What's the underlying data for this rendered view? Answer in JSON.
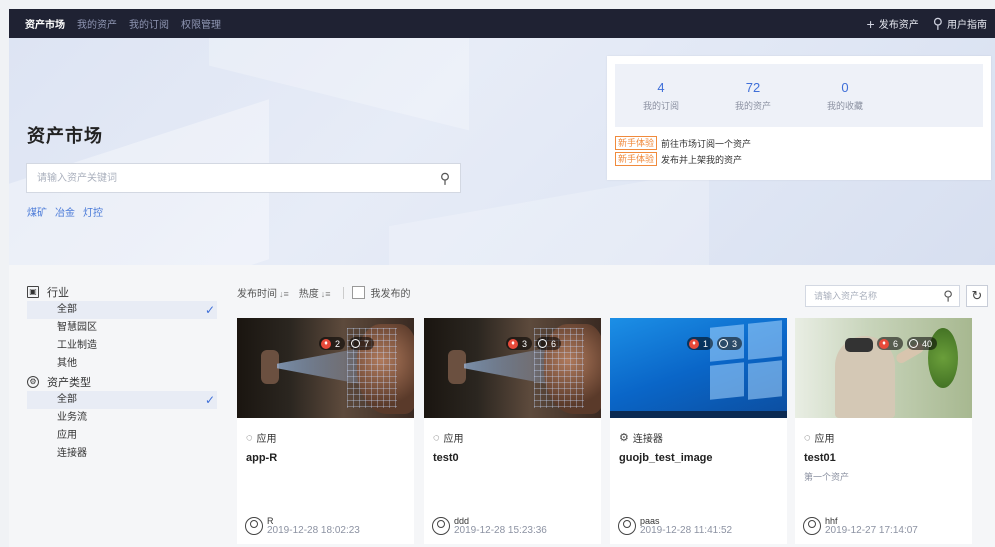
{
  "topbar": {
    "nav": [
      "资产市场",
      "我的资产",
      "我的订阅",
      "权限管理"
    ],
    "publish_label": "发布资产",
    "guide_label": "用户指南"
  },
  "hero": {
    "title": "资产市场",
    "search_placeholder": "请输入资产关键词",
    "tags": [
      "煤矿",
      "冶金",
      "灯控"
    ]
  },
  "stats": {
    "items": [
      {
        "value": "4",
        "label": "我的订阅"
      },
      {
        "value": "72",
        "label": "我的资产"
      },
      {
        "value": "0",
        "label": "我的收藏"
      }
    ],
    "newbie": [
      {
        "tag": "新手体验",
        "text": "前往市场订阅一个资产"
      },
      {
        "tag": "新手体验",
        "text": "发布并上架我的资产"
      }
    ]
  },
  "sidebar": {
    "industry_title": "行业",
    "industry_items": [
      "全部",
      "智慧园区",
      "工业制造",
      "其他"
    ],
    "type_title": "资产类型",
    "type_items": [
      "全部",
      "业务流",
      "应用",
      "连接器"
    ]
  },
  "toolbar": {
    "sort_time": "发布时间",
    "sort_hot": "热度",
    "my_published": "我发布的",
    "name_search_placeholder": "请输入资产名称"
  },
  "cards": [
    {
      "type": "应用",
      "name": "app-R",
      "desc": "",
      "owner": "R",
      "time": "2019-12-28 18:02:23",
      "hot": "2",
      "views": "7"
    },
    {
      "type": "应用",
      "name": "test0",
      "desc": "",
      "owner": "ddd",
      "time": "2019-12-28 15:23:36",
      "hot": "3",
      "views": "6"
    },
    {
      "type": "连接器",
      "name": "guojb_test_image",
      "desc": "",
      "owner": "paas",
      "time": "2019-12-28 11:41:52",
      "hot": "1",
      "views": "3"
    },
    {
      "type": "应用",
      "name": "test01",
      "desc": "第一个资产",
      "owner": "hhf",
      "time": "2019-12-27 17:14:07",
      "hot": "6",
      "views": "40"
    }
  ],
  "colors": {
    "accent": "#3f6fd8",
    "topbar": "#1f2233",
    "newbie_tag": "#f08a3c"
  }
}
